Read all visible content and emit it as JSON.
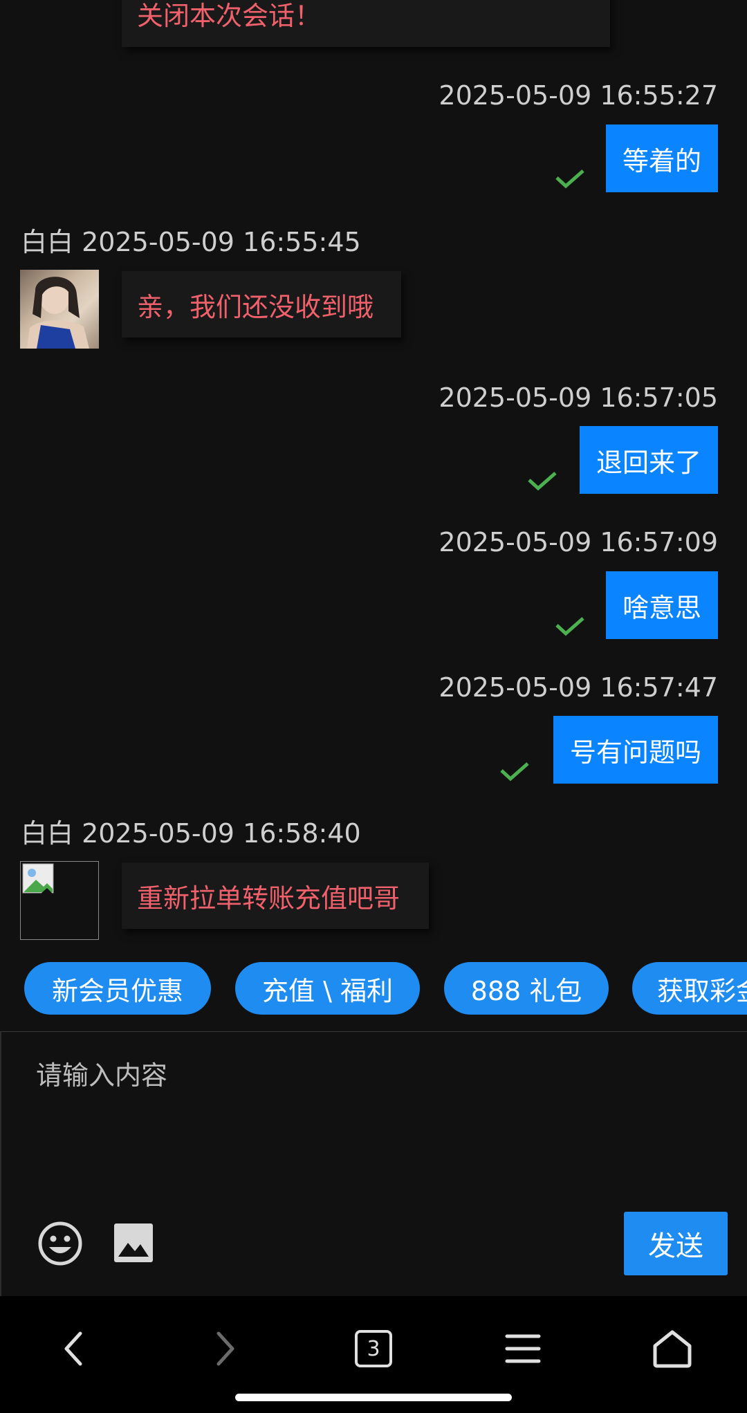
{
  "colors": {
    "accent": "#1e8cf0",
    "outgoing_bubble": "#0a84ff",
    "incoming_text": "#f0616c",
    "check": "#4caf50",
    "background": "#111112"
  },
  "messages": {
    "m0": {
      "text": "关闭本次会话！"
    },
    "m1": {
      "time": "2025-05-09 16:55:27",
      "text": "等着的",
      "status": "delivered"
    },
    "m2": {
      "sender": "白白",
      "time": "2025-05-09 16:55:45",
      "text": "亲，我们还没收到哦"
    },
    "m3": {
      "time": "2025-05-09 16:57:05",
      "text": "退回来了",
      "status": "delivered"
    },
    "m4": {
      "time": "2025-05-09 16:57:09",
      "text": "啥意思",
      "status": "delivered"
    },
    "m5": {
      "time": "2025-05-09 16:57:47",
      "text": "号有问题吗",
      "status": "delivered"
    },
    "m6": {
      "sender": "白白",
      "time": "2025-05-09 16:58:40",
      "text": "重新拉单转账充值吧哥",
      "avatar": "broken-image-icon"
    }
  },
  "quick_replies": [
    "新会员优惠",
    "充值 \\ 福利",
    "888 礼包",
    "获取彩金"
  ],
  "composer": {
    "placeholder": "请输入内容",
    "send_label": "发送"
  },
  "navbar": {
    "tabs_count": "3"
  }
}
